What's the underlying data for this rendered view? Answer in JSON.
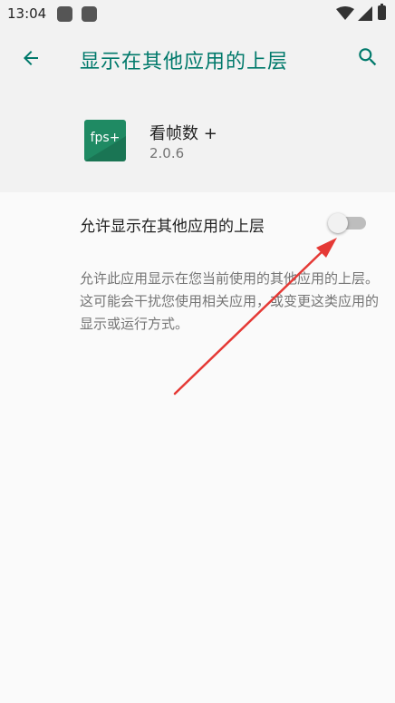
{
  "status_bar": {
    "time": "13:04"
  },
  "app_bar": {
    "title": "显示在其他应用的上层",
    "back_icon": "arrow-back-icon",
    "search_icon": "search-icon",
    "accent_color": "#00796b"
  },
  "app_info": {
    "icon_text": "fps+",
    "name": "看帧数 +",
    "version": "2.0.6",
    "icon_color": "#1f8a63"
  },
  "permission": {
    "label": "允许显示在其他应用的上层",
    "toggle_on": false,
    "description": "允许此应用显示在您当前使用的其他应用的上层。这可能会干扰您使用相关应用，或变更这类应用的显示或运行方式。"
  },
  "annotation": {
    "arrow_color": "#e53935"
  }
}
